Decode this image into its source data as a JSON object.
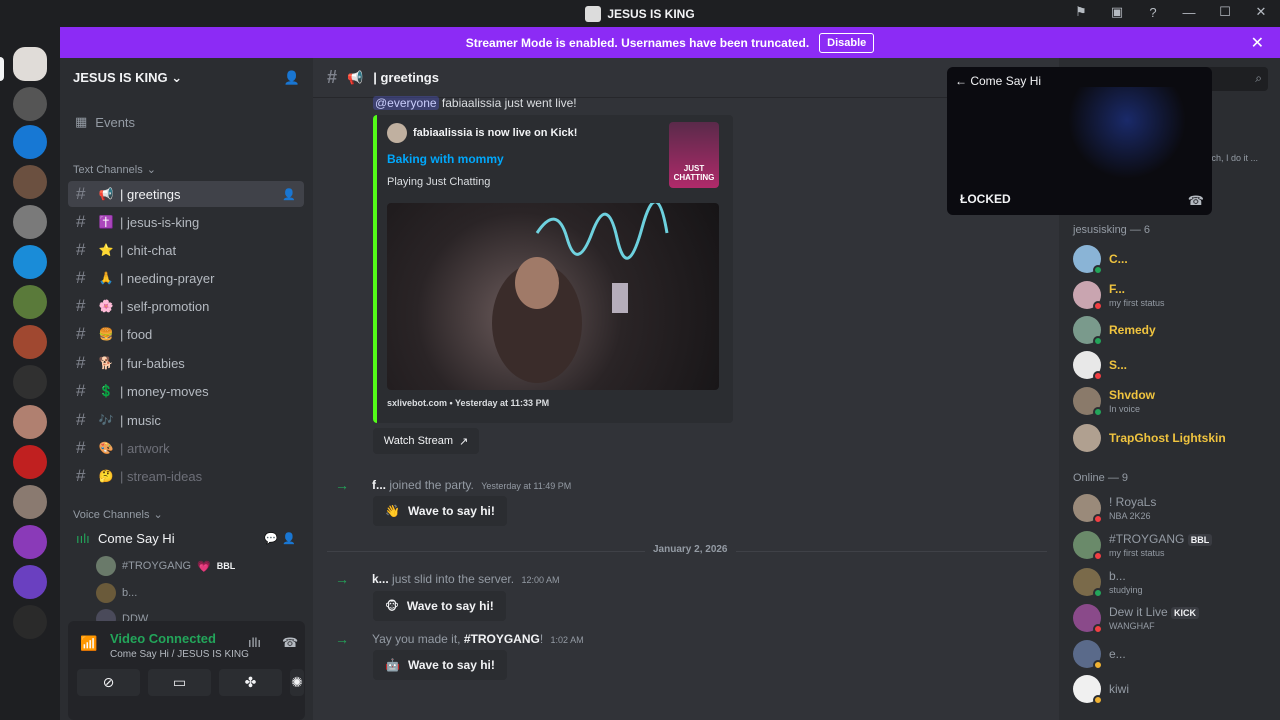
{
  "window": {
    "title": "JESUS IS KING"
  },
  "banner": {
    "text": "Streamer Mode is enabled. Usernames have been truncated.",
    "button": "Disable"
  },
  "server": {
    "name": "JESUS IS KING"
  },
  "sidebar": {
    "events": "Events",
    "text_category": "Text Channels",
    "channels": [
      {
        "name": "| greetings",
        "emoji": "📢"
      },
      {
        "name": "| jesus-is-king",
        "emoji": "✝️"
      },
      {
        "name": "| chit-chat",
        "emoji": "⭐"
      },
      {
        "name": "| needing-prayer",
        "emoji": "🙏"
      },
      {
        "name": "| self-promotion",
        "emoji": "🌸"
      },
      {
        "name": "| food",
        "emoji": "🍔"
      },
      {
        "name": "| fur-babies",
        "emoji": "🐕"
      },
      {
        "name": "| money-moves",
        "emoji": "💲"
      },
      {
        "name": "| music",
        "emoji": "🎶"
      },
      {
        "name": "| artwork",
        "emoji": "🎨"
      },
      {
        "name": "| stream-ideas",
        "emoji": "🤔"
      }
    ],
    "voice_category": "Voice Channels",
    "voice_channel": "Come Say Hi",
    "voice_members": [
      {
        "name": "#TROYGANG",
        "badge": "BBL"
      },
      {
        "name": "b..."
      },
      {
        "name": "DDW"
      }
    ]
  },
  "voicebar": {
    "status": "Video Connected",
    "sub": "Come Say Hi / JESUS IS KING"
  },
  "channel_header": {
    "name": "| greetings"
  },
  "messages": {
    "live_text_mention": "@everyone",
    "live_text": "fabiaalissia just went live!",
    "embed": {
      "author": "fabiaalissia is now live on Kick!",
      "title": "Baking with mommy",
      "desc": "Playing Just Chatting",
      "footer": "sxlivebot.com • Yesterday at 11:33 PM",
      "thumb_text": "JUST CHATTING"
    },
    "watch_button": "Watch Stream",
    "join1": {
      "user": "f...",
      "text": "joined the party.",
      "time": "Yesterday at 11:49 PM"
    },
    "wave_label": "Wave to say hi!",
    "date_divider": "January 2, 2026",
    "join2": {
      "user": "k...",
      "text": "just slid into the server.",
      "time": "12:00 AM"
    },
    "join3": {
      "pre": "Yay you made it,",
      "user": "#TROYGANG",
      "post": "!",
      "time": "1:02 AM"
    }
  },
  "popout": {
    "back_label": "Come Say Hi",
    "locked": "ŁOCKED"
  },
  "members": {
    "partial_text": "tch, I do it ...",
    "group1": "jesusisking — 6",
    "list1": [
      {
        "name": "C...",
        "sub": "",
        "color": "#8ab4d6"
      },
      {
        "name": "F...",
        "sub": "my first status",
        "color": "#c9a5b0"
      },
      {
        "name": "Remedy",
        "sub": "",
        "color": "#7a9a8c"
      },
      {
        "name": "S...",
        "sub": "",
        "color": "#e8e8e8"
      },
      {
        "name": "Shvdow",
        "sub": "In voice",
        "color": "#8a7a6a"
      },
      {
        "name": "TrapGhost Lightskin",
        "sub": "",
        "color": "#b0a090"
      }
    ],
    "group2": "Online — 9",
    "list2": [
      {
        "name": "! RoyaLs",
        "sub": "NBA 2K26",
        "color": "#9a8a7a"
      },
      {
        "name": "#TROYGANG",
        "sub": "my first status",
        "badge": "BBL",
        "color": "#6a8a6a"
      },
      {
        "name": "b...",
        "sub": "studying",
        "color": "#7a6a4a"
      },
      {
        "name": "Dew it Live",
        "sub": "WANGHAF",
        "badge": "KICK",
        "color": "#8a4a8a"
      },
      {
        "name": "e...",
        "sub": "",
        "color": "#5a6a8a"
      },
      {
        "name": "kiwi",
        "sub": "",
        "color": "#f0f0f0"
      }
    ]
  }
}
